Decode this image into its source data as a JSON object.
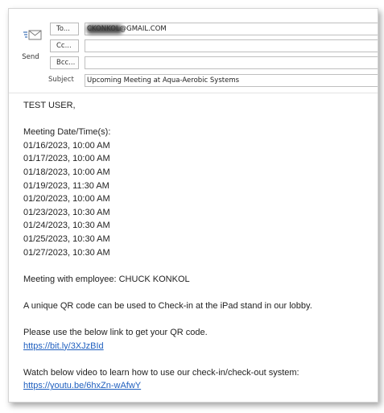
{
  "header": {
    "send_label": "Send",
    "to_button": "To...",
    "cc_button": "Cc...",
    "bcc_button": "Bcc...",
    "to_value": "CKONKOL@GMAIL.COM",
    "cc_value": "",
    "bcc_value": "",
    "subject_label": "Subject",
    "subject_value": "Upcoming Meeting at Aqua-Aerobic Systems"
  },
  "body": {
    "greeting": "TEST USER,",
    "meeting_heading": "Meeting Date/Time(s):",
    "meetings": [
      "01/16/2023,  10:00 AM",
      "01/17/2023,  10:00 AM",
      "01/18/2023,  10:00 AM",
      "01/19/2023,  11:30 AM",
      "01/20/2023,  10:00 AM",
      "01/23/2023,  10:30 AM",
      "01/24/2023,  10:30 AM",
      "01/25/2023,  10:30 AM",
      "01/27/2023,  10:30 AM"
    ],
    "meeting_with": "Meeting with employee: CHUCK KONKOL",
    "qr_info": "A unique QR code can be used to Check-in at the iPad stand in our lobby.",
    "qr_link_intro": "Please use the below link to get your QR code.",
    "qr_link": "https://bit.ly/3XJzBId",
    "video_intro": "Watch below video to learn how to use our check-in/check-out system:",
    "video_link": "https://youtu.be/6hxZn-wAfwY"
  },
  "icons": {
    "send": "send-mail-icon"
  },
  "colors": {
    "link": "#1f5fbf"
  }
}
